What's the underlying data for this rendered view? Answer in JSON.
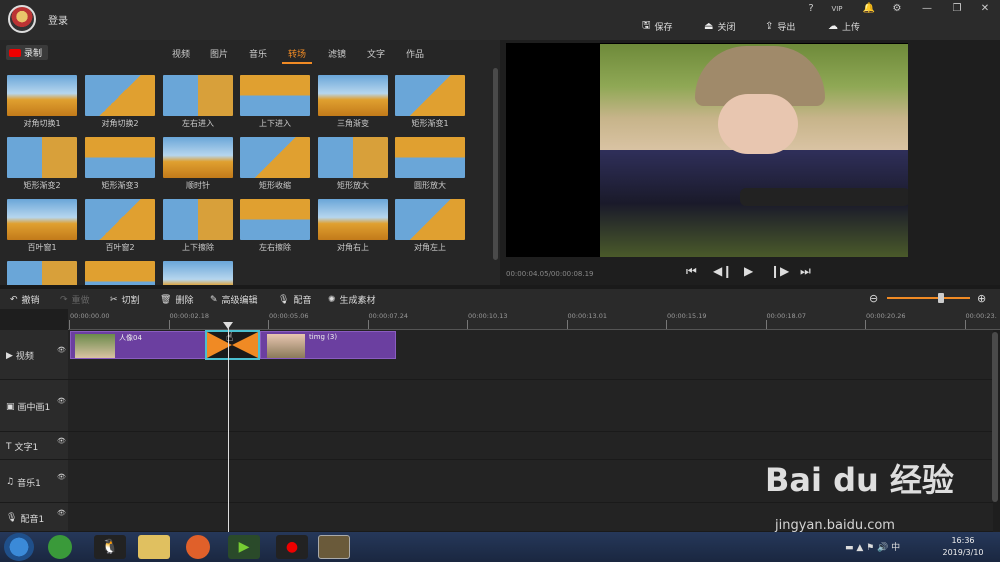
{
  "app": {
    "login": "登录",
    "window_buttons": [
      "?",
      "VIP",
      "🔔",
      "⚙",
      "—",
      "❐",
      "✕"
    ],
    "top_actions": [
      {
        "label": "保存",
        "icon": "save-icon",
        "glyph": "🖫"
      },
      {
        "label": "关闭",
        "icon": "close-icon",
        "glyph": "⏏"
      },
      {
        "label": "导出",
        "icon": "export-icon",
        "glyph": "⇪"
      },
      {
        "label": "上传",
        "icon": "upload-icon",
        "glyph": "☁"
      }
    ]
  },
  "library": {
    "record_label": "录制",
    "tabs": [
      "视频",
      "图片",
      "音乐",
      "转场",
      "滤镜",
      "文字",
      "作品"
    ],
    "active_tab": "转场",
    "transitions": [
      "对角切换1",
      "对角切换2",
      "左右进入",
      "上下进入",
      "三角渐变",
      "矩形渐变1",
      "矩形渐变2",
      "矩形渐变3",
      "顺时针",
      "矩形收缩",
      "矩形放大",
      "圆形放大",
      "百叶窗1",
      "百叶窗2",
      "上下擦除",
      "左右擦除",
      "对角右上",
      "对角左上",
      "",
      "",
      ""
    ]
  },
  "preview": {
    "timecode": "00:00:04.05/00:00:08.19",
    "controls": [
      "⏮",
      "◀❙",
      "▶",
      "❙▶",
      "⏭"
    ]
  },
  "toolbar": {
    "undo": "撤销",
    "redo": "重做",
    "cut": "切割",
    "delete": "删除",
    "advanced_edit": "高级编辑",
    "dub": "配音",
    "generate": "生成素材"
  },
  "zoom": {
    "level": 0.62
  },
  "timeline": {
    "ticks": [
      "00:00:00.00",
      "00:00:02.18",
      "00:00:05.06",
      "00:00:07.24",
      "00:00:10.13",
      "00:00:13.01",
      "00:00:15.19",
      "00:00:18.07",
      "00:00:20.26",
      "00:00:23."
    ],
    "tracks": [
      {
        "name": "视频",
        "icon": "video-track-icon",
        "glyph": "▶"
      },
      {
        "name": "画中画1",
        "icon": "pip-track-icon",
        "glyph": "▣"
      },
      {
        "name": "文字1",
        "icon": "text-track-icon",
        "glyph": "T"
      },
      {
        "name": "音乐1",
        "icon": "music-track-icon",
        "glyph": "♫"
      },
      {
        "name": "配音1",
        "icon": "mic-track-icon",
        "glyph": "🎙"
      }
    ],
    "clips": [
      {
        "label": "人像04"
      },
      {
        "label": "timg (3)"
      }
    ]
  },
  "taskbar": {
    "time": "16:36",
    "date": "2019/3/10"
  },
  "watermark": {
    "main": "Bai du 经验",
    "sub": "jingyan.baidu.com"
  }
}
